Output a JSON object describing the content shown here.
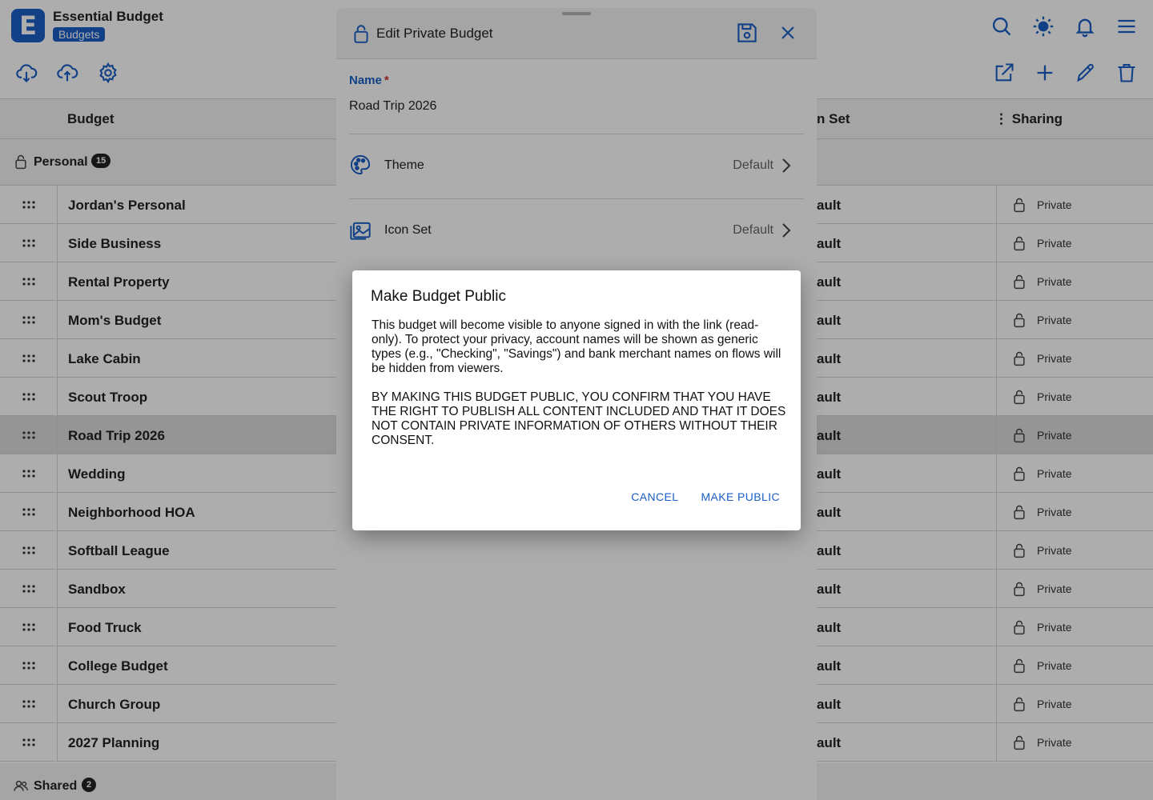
{
  "app": {
    "logo_letter": "E",
    "title": "Essential Budget",
    "chip": "Budgets"
  },
  "columns": {
    "budget": "Budget",
    "icon_set": "n Set",
    "sharing": "Sharing"
  },
  "groups": {
    "personal": {
      "label": "Personal",
      "count": "15"
    },
    "shared": {
      "label": "Shared",
      "count": "2"
    }
  },
  "rows": [
    {
      "name": "Jordan's Personal",
      "icon_set": "ault",
      "sharing": "Private"
    },
    {
      "name": "Side Business",
      "icon_set": "ault",
      "sharing": "Private"
    },
    {
      "name": "Rental Property",
      "icon_set": "ault",
      "sharing": "Private"
    },
    {
      "name": "Mom's Budget",
      "icon_set": "ault",
      "sharing": "Private"
    },
    {
      "name": "Lake Cabin",
      "icon_set": "ault",
      "sharing": "Private"
    },
    {
      "name": "Scout Troop",
      "icon_set": "ault",
      "sharing": "Private"
    },
    {
      "name": "Road Trip 2026",
      "icon_set": "ault",
      "sharing": "Private"
    },
    {
      "name": "Wedding",
      "icon_set": "ault",
      "sharing": "Private"
    },
    {
      "name": "Neighborhood HOA",
      "icon_set": "ault",
      "sharing": "Private"
    },
    {
      "name": "Softball League",
      "icon_set": "ault",
      "sharing": "Private"
    },
    {
      "name": "Sandbox",
      "icon_set": "ault",
      "sharing": "Private"
    },
    {
      "name": "Food Truck",
      "icon_set": "ault",
      "sharing": "Private"
    },
    {
      "name": "College Budget",
      "icon_set": "ault",
      "sharing": "Private"
    },
    {
      "name": "Church Group",
      "icon_set": "ault",
      "sharing": "Private"
    },
    {
      "name": "2027 Planning",
      "icon_set": "ault",
      "sharing": "Private"
    }
  ],
  "sheet": {
    "title": "Edit Private Budget",
    "name_label": "Name",
    "name_required": "*",
    "name_value": "Road Trip 2026",
    "theme_label": "Theme",
    "theme_value": "Default",
    "icon_set_label": "Icon Set",
    "icon_set_value": "Default"
  },
  "alert": {
    "title": "Make Budget Public",
    "body_1": "This budget will become visible to anyone signed in with the link (read-only). To protect your privacy, account names will be shown as generic types (e.g., \"Checking\", \"Savings\") and bank merchant names on flows will be hidden from viewers.",
    "body_2": "BY MAKING THIS BUDGET PUBLIC, YOU CONFIRM THAT YOU HAVE THE RIGHT TO PUBLISH ALL CONTENT INCLUDED AND THAT IT DOES NOT CONTAIN PRIVATE INFORMATION OF OTHERS WITHOUT THEIR CONSENT.",
    "cancel": "CANCEL",
    "confirm": "MAKE PUBLIC"
  },
  "colors": {
    "accent": "#1a5fc7",
    "required": "#d32f2f"
  }
}
